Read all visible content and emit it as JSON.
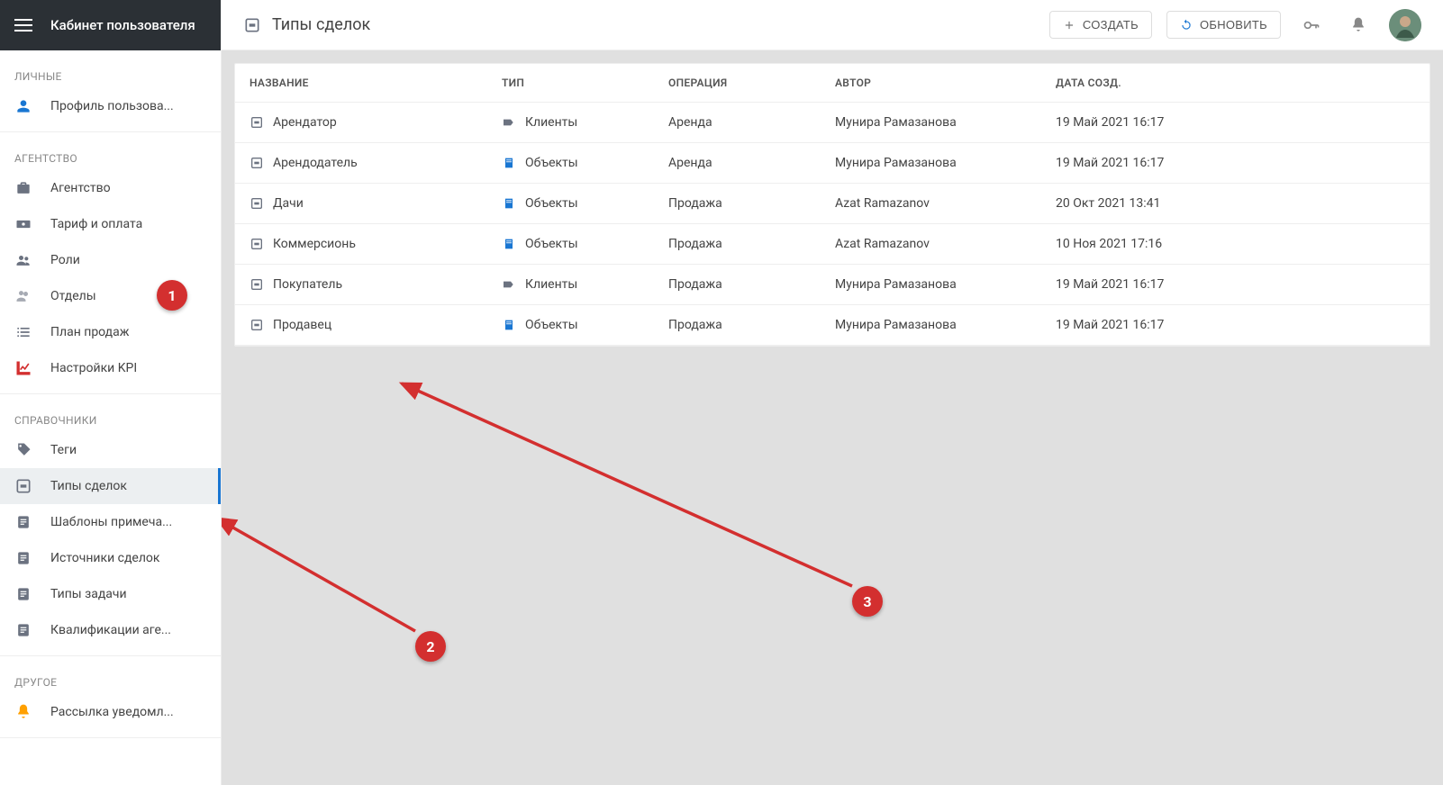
{
  "sidebar": {
    "title": "Кабинет пользователя",
    "sections": [
      {
        "label": "ЛИЧНЫЕ",
        "items": [
          {
            "icon": "user",
            "label": "Профиль пользова..."
          }
        ]
      },
      {
        "label": "АГЕНТСТВО",
        "items": [
          {
            "icon": "briefcase",
            "label": "Агентство"
          },
          {
            "icon": "cash",
            "label": "Тариф и оплата"
          },
          {
            "icon": "users",
            "label": "Роли"
          },
          {
            "icon": "users-alt",
            "label": "Отделы"
          },
          {
            "icon": "list",
            "label": "План продаж"
          },
          {
            "icon": "chart",
            "label": "Настройки KPI"
          }
        ]
      },
      {
        "label": "СПРАВОЧНИКИ",
        "items": [
          {
            "icon": "tag",
            "label": "Теги"
          },
          {
            "icon": "deal",
            "label": "Типы сделок",
            "active": true
          },
          {
            "icon": "note",
            "label": "Шаблоны примеча..."
          },
          {
            "icon": "note",
            "label": "Источники сделок"
          },
          {
            "icon": "note",
            "label": "Типы задачи"
          },
          {
            "icon": "note",
            "label": "Квалификации аге..."
          }
        ]
      },
      {
        "label": "ДРУГОЕ",
        "items": [
          {
            "icon": "bell",
            "label": "Рассылка уведомл..."
          }
        ]
      }
    ]
  },
  "header": {
    "title": "Типы сделок",
    "create_btn": "СОЗДАТЬ",
    "refresh_btn": "ОБНОВИТЬ"
  },
  "table": {
    "columns": {
      "name": "НАЗВАНИЕ",
      "type": "ТИП",
      "operation": "ОПЕРАЦИЯ",
      "author": "АВТОР",
      "created": "ДАТА СОЗД."
    },
    "rows": [
      {
        "name": "Арендатор",
        "type_icon": "clients",
        "type": "Клиенты",
        "op": "Аренда",
        "author": "Мунира Рамазанова",
        "date": "19 Май 2021 16:17"
      },
      {
        "name": "Арендодатель",
        "type_icon": "objects",
        "type": "Объекты",
        "op": "Аренда",
        "author": "Мунира Рамазанова",
        "date": "19 Май 2021 16:17"
      },
      {
        "name": "Дачи",
        "type_icon": "objects",
        "type": "Объекты",
        "op": "Продажа",
        "author": "Azat Ramazanov",
        "date": "20 Окт 2021 13:41"
      },
      {
        "name": "Коммерсионь",
        "type_icon": "objects",
        "type": "Объекты",
        "op": "Продажа",
        "author": "Azat Ramazanov",
        "date": "10 Ноя 2021 17:16"
      },
      {
        "name": "Покупатель",
        "type_icon": "clients",
        "type": "Клиенты",
        "op": "Продажа",
        "author": "Мунира Рамазанова",
        "date": "19 Май 2021 16:17"
      },
      {
        "name": "Продавец",
        "type_icon": "objects",
        "type": "Объекты",
        "op": "Продажа",
        "author": "Мунира Рамазанова",
        "date": "19 Май 2021 16:17"
      }
    ]
  },
  "annotations": {
    "n1": "1",
    "n2": "2",
    "n3": "3"
  }
}
